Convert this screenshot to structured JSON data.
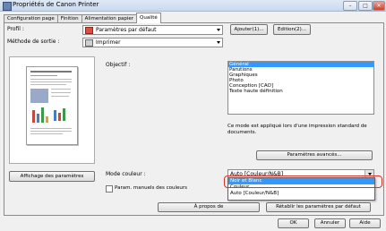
{
  "window": {
    "title": "Propriétés de Canon Printer",
    "controls": {
      "minimize": "–",
      "maximize": "□",
      "close": "✕"
    }
  },
  "tabs": [
    {
      "label": "Configuration page"
    },
    {
      "label": "Finition"
    },
    {
      "label": "Alimentation papier"
    },
    {
      "label": "Qualité",
      "active": true
    }
  ],
  "profile": {
    "label": "Profil :",
    "value": "Paramètres par défaut",
    "add_button": "Ajouter(1)...",
    "edit_button": "Edition(2)..."
  },
  "output_method": {
    "label": "Méthode de sortie :",
    "value": "Imprimer"
  },
  "objective": {
    "label": "Objectif :",
    "items": [
      {
        "label": "Général",
        "selected": true
      },
      {
        "label": "Parutions"
      },
      {
        "label": "Graphiques"
      },
      {
        "label": "Photo"
      },
      {
        "label": "Conception [CAO]"
      },
      {
        "label": "Texte haute définition"
      }
    ],
    "description": "Ce mode est appliqué lors d'une impression standard de documents."
  },
  "advanced_button": "Paramètres avancés...",
  "show_settings_button": "Affichage des paramètres",
  "color_mode": {
    "label": "Mode couleur :",
    "value": "Auto [Couleur/N&B]",
    "options": [
      {
        "label": "Noir et Blanc",
        "highlighted": true
      },
      {
        "label": "Couleur"
      },
      {
        "label": "Auto [Couleur/N&B]"
      }
    ]
  },
  "manual_color": {
    "label": "Param. manuels des couleurs",
    "checked": false
  },
  "about_button": "À propos de",
  "restore_defaults_button": "Rétablir les paramètres par défaut",
  "footer": {
    "ok": "OK",
    "cancel": "Annuler",
    "help": "Aide"
  },
  "colors": {
    "selection": "#3399ff",
    "highlight_ring": "#d9322b",
    "panel": "#f0f0f0"
  }
}
